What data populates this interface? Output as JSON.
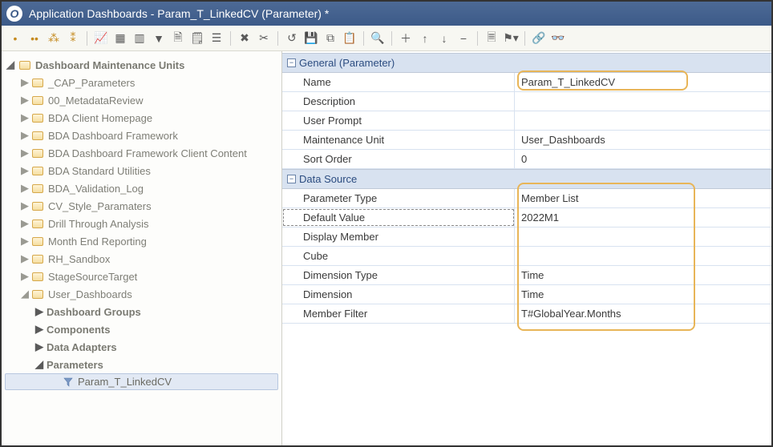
{
  "title": "Application Dashboards - Param_T_LinkedCV (Parameter) *",
  "tree": {
    "root": "Dashboard Maintenance Units",
    "items": [
      "_CAP_Parameters",
      "00_MetadataReview",
      "BDA Client Homepage",
      "BDA Dashboard Framework",
      "BDA Dashboard Framework Client Content",
      "BDA Standard Utilities",
      "BDA_Validation_Log",
      "CV_Style_Paramaters",
      "Drill Through Analysis",
      "Month End Reporting",
      "RH_Sandbox",
      "StageSourceTarget",
      "User_Dashboards"
    ],
    "user_dash_children": [
      "Dashboard Groups",
      "Components",
      "Data Adapters",
      "Parameters"
    ],
    "selected_param": "Param_T_LinkedCV"
  },
  "sections": {
    "general": {
      "header": "General (Parameter)",
      "rows": [
        {
          "label": "Name",
          "value": "Param_T_LinkedCV"
        },
        {
          "label": "Description",
          "value": ""
        },
        {
          "label": "User Prompt",
          "value": ""
        },
        {
          "label": "Maintenance Unit",
          "value": "User_Dashboards"
        },
        {
          "label": "Sort Order",
          "value": "0"
        }
      ]
    },
    "datasource": {
      "header": "Data Source",
      "rows": [
        {
          "label": "Parameter Type",
          "value": "Member List"
        },
        {
          "label": "Default Value",
          "value": "2022M1"
        },
        {
          "label": "Display Member",
          "value": ""
        },
        {
          "label": "Cube",
          "value": ""
        },
        {
          "label": "Dimension Type",
          "value": "Time"
        },
        {
          "label": "Dimension",
          "value": "Time"
        },
        {
          "label": "Member Filter",
          "value": "T#GlobalYear.Months"
        }
      ]
    }
  }
}
